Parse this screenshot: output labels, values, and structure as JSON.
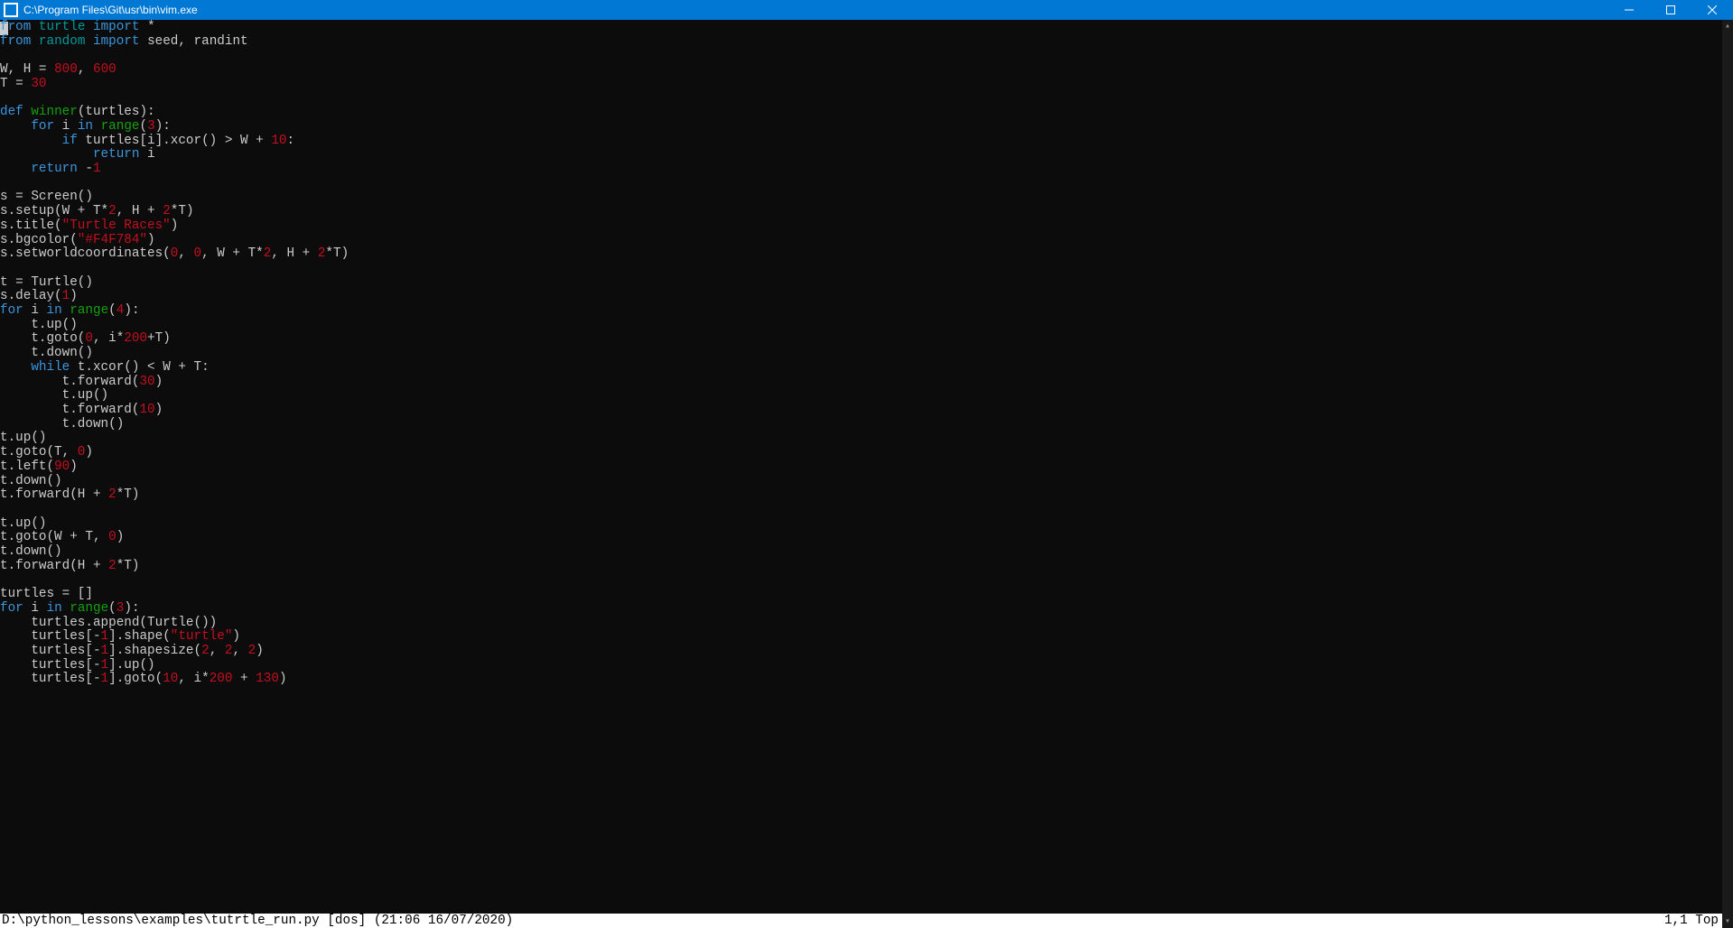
{
  "window": {
    "title": "C:\\Program Files\\Git\\usr\\bin\\vim.exe"
  },
  "statusbar": {
    "left": "D:\\python_lessons\\examples\\tutrtle_run.py [dos] (21:06 16/07/2020)",
    "right": "1,1 Top"
  },
  "code": {
    "l1_kw1": "from",
    "l1_id1": "turtle",
    "l1_kw2": "import",
    "l1_rest": " *",
    "l2_kw1": "from",
    "l2_id1": "random",
    "l2_kw2": "import",
    "l2_rest": " seed, randint",
    "l4_a": "W, H = ",
    "l4_n1": "800",
    "l4_b": ", ",
    "l4_n2": "600",
    "l5_a": "T = ",
    "l5_n1": "30",
    "l7_kw": "def",
    "l7_fn": "winner",
    "l7_rest": "(turtles):",
    "l8_a": "    ",
    "l8_kw": "for",
    "l8_b": " i ",
    "l8_kw2": "in",
    "l8_c": " ",
    "l8_fn": "range",
    "l8_d": "(",
    "l8_n": "3",
    "l8_e": "):",
    "l9_a": "        ",
    "l9_kw": "if",
    "l9_b": " turtles[i].xcor() > W + ",
    "l9_n": "10",
    "l9_c": ":",
    "l10_a": "            ",
    "l10_kw": "return",
    "l10_b": " i",
    "l11_a": "    ",
    "l11_kw": "return",
    "l11_b": " -",
    "l11_n": "1",
    "l13": "s = Screen()",
    "l14_a": "s.setup(W + T*",
    "l14_n1": "2",
    "l14_b": ", H + ",
    "l14_n2": "2",
    "l14_c": "*T)",
    "l15_a": "s.title(",
    "l15_s": "\"Turtle Races\"",
    "l15_b": ")",
    "l16_a": "s.bgcolor(",
    "l16_s": "\"#F4F784\"",
    "l16_b": ")",
    "l17_a": "s.setworldcoordinates(",
    "l17_n1": "0",
    "l17_b": ", ",
    "l17_n2": "0",
    "l17_c": ", W + T*",
    "l17_n3": "2",
    "l17_d": ", H + ",
    "l17_n4": "2",
    "l17_e": "*T)",
    "l19": "t = Turtle()",
    "l20_a": "s.delay(",
    "l20_n": "1",
    "l20_b": ")",
    "l21_kw": "for",
    "l21_a": " i ",
    "l21_kw2": "in",
    "l21_b": " ",
    "l21_fn": "range",
    "l21_c": "(",
    "l21_n": "4",
    "l21_d": "):",
    "l22": "    t.up()",
    "l23_a": "    t.goto(",
    "l23_n1": "0",
    "l23_b": ", i*",
    "l23_n2": "200",
    "l23_c": "+T)",
    "l24": "    t.down()",
    "l25_a": "    ",
    "l25_kw": "while",
    "l25_b": " t.xcor() < W + T:",
    "l26_a": "        t.forward(",
    "l26_n": "30",
    "l26_b": ")",
    "l27": "        t.up()",
    "l28_a": "        t.forward(",
    "l28_n": "10",
    "l28_b": ")",
    "l29": "        t.down()",
    "l30": "t.up()",
    "l31_a": "t.goto(T, ",
    "l31_n": "0",
    "l31_b": ")",
    "l32_a": "t.left(",
    "l32_n": "90",
    "l32_b": ")",
    "l33": "t.down()",
    "l34_a": "t.forward(H + ",
    "l34_n": "2",
    "l34_b": "*T)",
    "l36": "t.up()",
    "l37_a": "t.goto(W + T, ",
    "l37_n": "0",
    "l37_b": ")",
    "l38": "t.down()",
    "l39_a": "t.forward(H + ",
    "l39_n": "2",
    "l39_b": "*T)",
    "l41": "turtles = []",
    "l42_kw": "for",
    "l42_a": " i ",
    "l42_kw2": "in",
    "l42_b": " ",
    "l42_fn": "range",
    "l42_c": "(",
    "l42_n": "3",
    "l42_d": "):",
    "l43": "    turtles.append(Turtle())",
    "l44_a": "    turtles[-",
    "l44_n": "1",
    "l44_b": "].shape(",
    "l44_s": "\"turtle\"",
    "l44_c": ")",
    "l45_a": "    turtles[-",
    "l45_n1": "1",
    "l45_b": "].shapesize(",
    "l45_n2": "2",
    "l45_c": ", ",
    "l45_n3": "2",
    "l45_d": ", ",
    "l45_n4": "2",
    "l45_e": ")",
    "l46_a": "    turtles[-",
    "l46_n": "1",
    "l46_b": "].up()",
    "l47_a": "    turtles[-",
    "l47_n1": "1",
    "l47_b": "].goto(",
    "l47_n2": "10",
    "l47_c": ", i*",
    "l47_n3": "200",
    "l47_d": " + ",
    "l47_n4": "130",
    "l47_e": ")"
  }
}
